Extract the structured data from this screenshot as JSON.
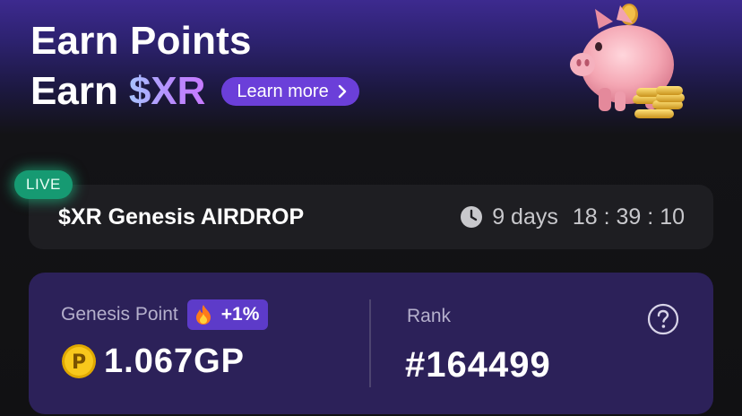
{
  "hero": {
    "title_line1": "Earn Points",
    "title_line2_prefix": "Earn",
    "title_line2_token": "$XR",
    "learn_more_label": "Learn more"
  },
  "airdrop": {
    "live_label": "LIVE",
    "title": "$XR Genesis AIRDROP",
    "countdown": {
      "days": "9 days",
      "hours": "18",
      "minutes": "39",
      "seconds": "10",
      "separator": " : "
    }
  },
  "points": {
    "label": "Genesis Point",
    "boost": "+1%",
    "value": "1.067",
    "unit": "GP",
    "coin_letter": "P"
  },
  "rank": {
    "label": "Rank",
    "value": "#164499"
  },
  "icons": {
    "hero_image": "piggy-bank-with-coins",
    "chevron": "chevron-right-icon",
    "clock": "clock-icon",
    "boost": "fire-icon",
    "coin": "points-coin-icon",
    "help": "question-circle-icon"
  },
  "colors": {
    "accent": "#6b3fd9",
    "live": "#169a72",
    "card": "#1e1e22",
    "points_card": "#2c2159",
    "coin": "#f5c400"
  }
}
